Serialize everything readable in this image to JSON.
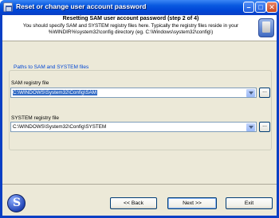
{
  "window": {
    "title": "Reset or change user account password",
    "controls": {
      "minimize": "–",
      "maximize": "□",
      "close": "✕"
    }
  },
  "header": {
    "title": "Resetting SAM user account password (step 2 of 4)",
    "description": "You should specify SAM and SYSTEM registry files here. Typically the registry files reside in your %WINDIR%\\system32\\config directory (eg. C:\\Windows\\system32\\config\\)",
    "icon": "registry-files-icon"
  },
  "group": {
    "label": "Paths to SAM and SYSTEM files",
    "sam": {
      "label": "SAM registry file",
      "value": "C:\\WINDOWS\\System32\\Config\\SAM",
      "browse_label": "..."
    },
    "system": {
      "label": "SYSTEM registry file",
      "value": "C:\\WINDOWS\\System32\\Config\\SYSTEM",
      "browse_label": "..."
    }
  },
  "footer": {
    "back_label": "<< Back",
    "next_label": "Next >>",
    "exit_label": "Exit"
  },
  "colors": {
    "titlebar": "#0a5ae0",
    "dialog_bg": "#ece9d8",
    "group_label": "#0046d5",
    "selection": "#316ac5"
  }
}
